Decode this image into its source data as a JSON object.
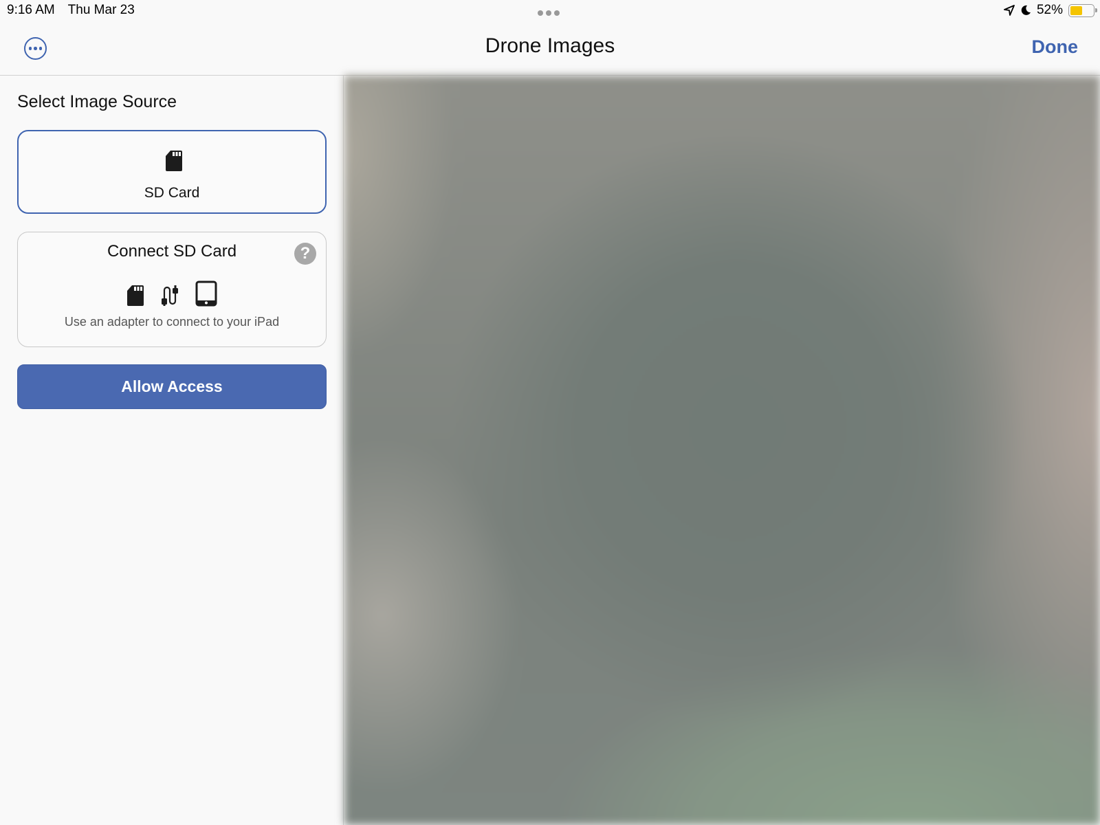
{
  "status_bar": {
    "time": "9:16 AM",
    "date": "Thu Mar 23",
    "battery_percent_label": "52%",
    "battery_level": 0.52,
    "battery_color": "#f5c400",
    "icons": [
      "location-arrow-icon",
      "moon-icon",
      "battery-icon"
    ]
  },
  "nav": {
    "title": "Drone Images",
    "done_label": "Done",
    "more_icon": "ellipsis-circle-icon",
    "accent_color": "#3f64b0"
  },
  "sidebar": {
    "section_title": "Select Image Source",
    "source_option": {
      "label": "SD Card",
      "icon": "sd-card-icon",
      "selected": true
    },
    "connect_card": {
      "title": "Connect SD Card",
      "help_icon": "question-circle-icon",
      "help_glyph": "?",
      "icons": [
        "sd-card-icon",
        "cable-icon",
        "ipad-icon"
      ],
      "description": "Use an adapter to connect to your iPad"
    },
    "allow_button_label": "Allow Access",
    "button_color": "#4a69b1"
  },
  "preview": {
    "description": "blurred drone image"
  }
}
